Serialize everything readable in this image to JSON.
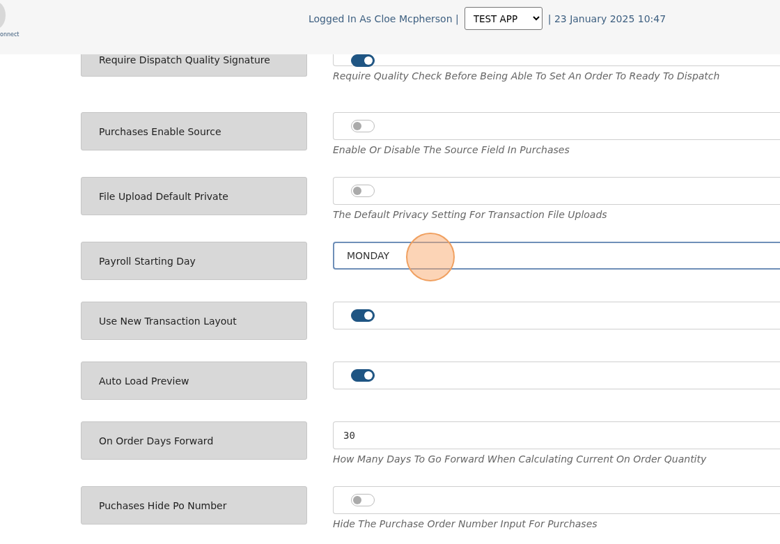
{
  "header": {
    "logo_text": "onnect",
    "user_text": "Logged In As Cloe Mcpherson |",
    "app_select": "TEST APP",
    "datetime_text": "| 23 January 2025 10:47"
  },
  "settings": [
    {
      "label": "Require Dispatch Quality Signature",
      "kind": "toggle",
      "on": true,
      "description": "Require Quality Check Before Being Able To Set An Order To Ready To Dispatch"
    },
    {
      "label": "Purchases Enable Source",
      "kind": "toggle",
      "on": false,
      "description": "Enable Or Disable The Source Field In Purchases"
    },
    {
      "label": "File Upload Default Private",
      "kind": "toggle",
      "on": false,
      "description": "The Default Privacy Setting For Transaction File Uploads"
    },
    {
      "label": "Payroll Starting Day",
      "kind": "select",
      "value": "MONDAY",
      "focused": true
    },
    {
      "label": "Use New Transaction Layout",
      "kind": "toggle",
      "on": true
    },
    {
      "label": "Auto Load Preview",
      "kind": "toggle",
      "on": true
    },
    {
      "label": "On Order Days Forward",
      "kind": "number",
      "value": "30",
      "description": "How Many Days To Go Forward When Calculating Current On Order Quantity"
    },
    {
      "label": "Puchases Hide Po Number",
      "kind": "toggle",
      "on": false,
      "description": "Hide The Purchase Order Number Input For Purchases"
    }
  ]
}
